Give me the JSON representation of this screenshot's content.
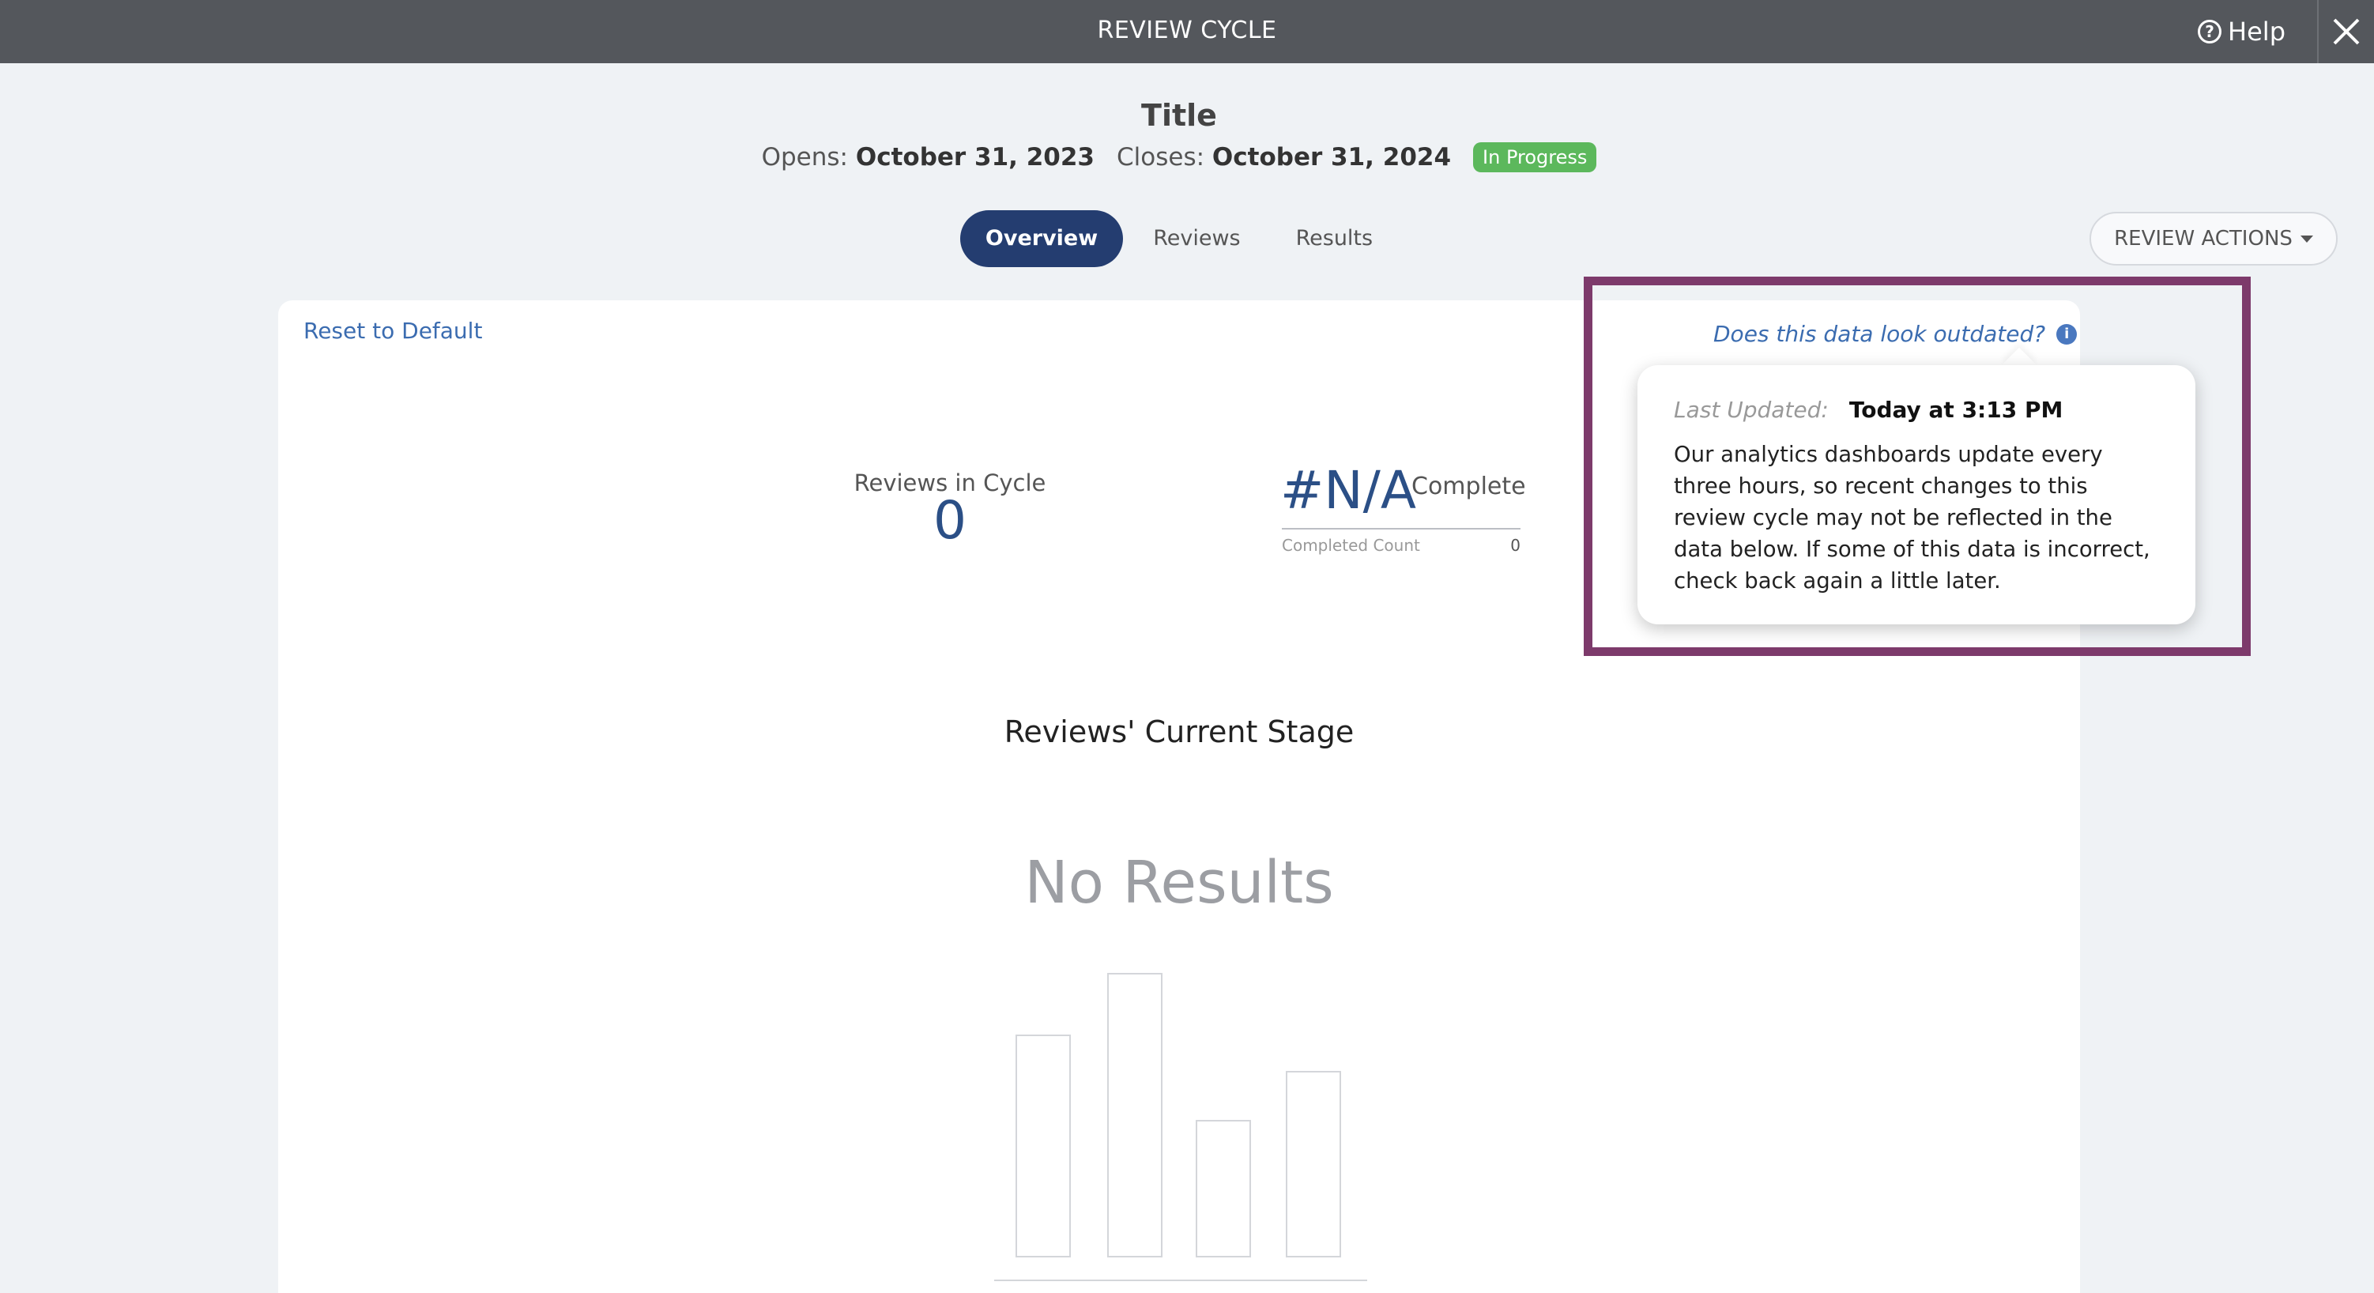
{
  "topbar": {
    "title": "REVIEW CYCLE",
    "help_label": "Help",
    "help_icon": "question-circle-icon",
    "close_icon": "close-icon"
  },
  "header": {
    "title": "Title",
    "opens_label": "Opens:",
    "opens_date": "October 31, 2023",
    "closes_label": "Closes:",
    "closes_date": "October 31, 2024",
    "status": "In Progress"
  },
  "tabs": [
    {
      "label": "Overview",
      "active": true
    },
    {
      "label": "Reviews",
      "active": false
    },
    {
      "label": "Results",
      "active": false
    }
  ],
  "review_actions_label": "REVIEW ACTIONS",
  "card": {
    "reset_label": "Reset to Default",
    "outdated_label": "Does this data look outdated?",
    "reviews_in_cycle_label": "Reviews in Cycle",
    "reviews_in_cycle_value": "0",
    "complete_value": "#N/A",
    "complete_label": "Complete",
    "completed_count_label": "Completed Count",
    "completed_count_value": "0",
    "stage_title": "Reviews' Current Stage",
    "no_results": "No Results"
  },
  "popover": {
    "last_updated_label": "Last Updated:",
    "last_updated_value": "Today at 3:13 PM",
    "body": "Our analytics dashboards update every three hours, so recent changes to this review cycle may not be reflected in the data below. If some of this data is incorrect, check back again a little later."
  },
  "colors": {
    "topbar": "#54575c",
    "accent_navy": "#243d70",
    "status_green": "#5cb85c",
    "link_blue": "#3b6cb0",
    "highlight": "#7d3a6b"
  }
}
